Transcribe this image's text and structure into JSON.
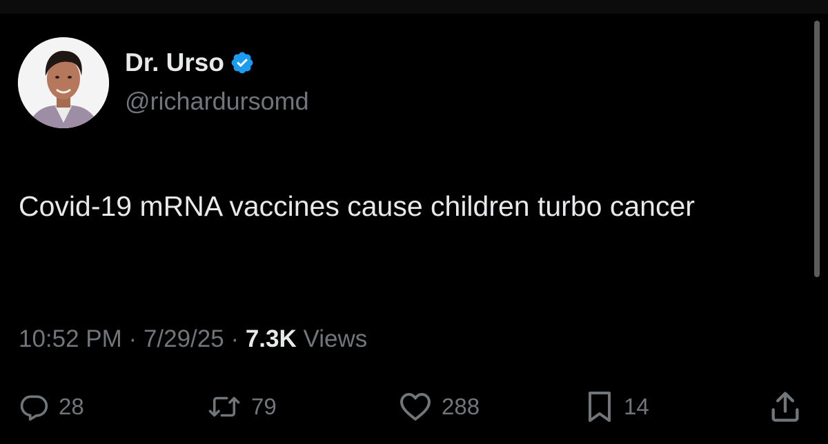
{
  "tweet": {
    "author": {
      "display_name": "Dr. Urso",
      "handle": "@richardursomd",
      "avatar_icon": "profile-photo",
      "verified": true,
      "verified_color": "#1d9bf0"
    },
    "text": "Covid-19 mRNA vaccines cause children turbo cancer",
    "meta": {
      "time": "10:52 PM",
      "date": "7/29/25",
      "separator": "·",
      "views_count": "7.3K",
      "views_label": "Views"
    },
    "actions": {
      "replies": {
        "icon": "reply-icon",
        "count": "28"
      },
      "reposts": {
        "icon": "repost-icon",
        "count": "79"
      },
      "likes": {
        "icon": "heart-icon",
        "count": "288"
      },
      "bookmarks": {
        "icon": "bookmark-icon",
        "count": "14"
      },
      "share": {
        "icon": "share-icon"
      }
    }
  },
  "colors": {
    "background": "#000000",
    "primary_text": "#e7e9ea",
    "secondary_text": "#71767b"
  }
}
